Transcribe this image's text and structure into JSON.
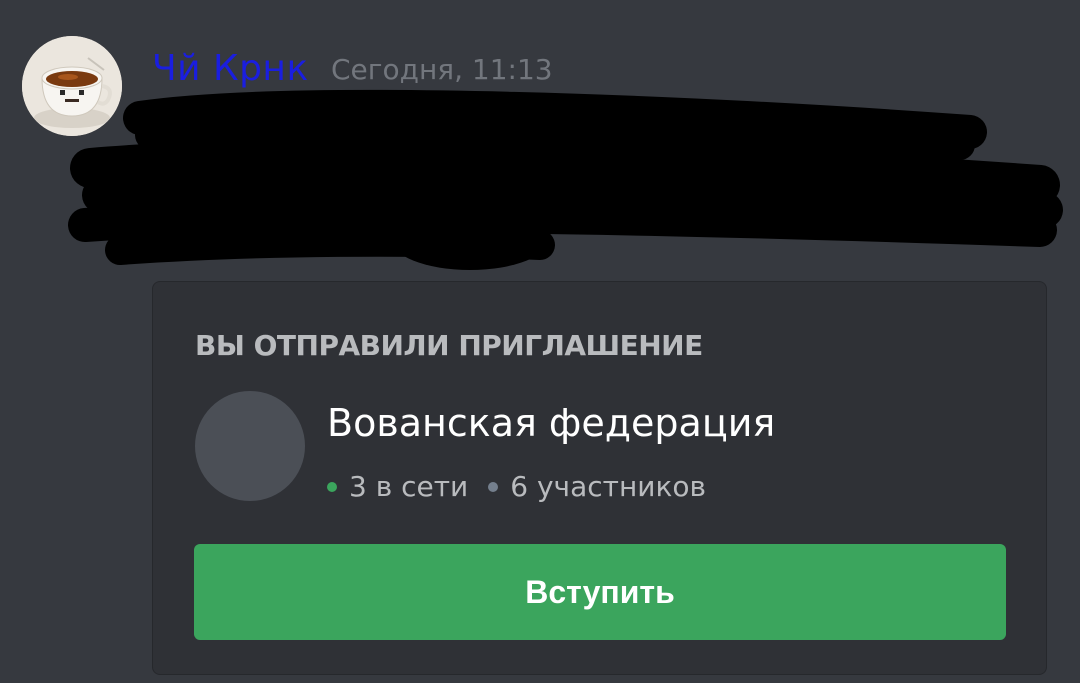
{
  "message": {
    "author": "Чй Крнк",
    "timestamp": "Сегодня, 11:13",
    "author_color": "#1a1ee0",
    "avatar_icon": "teacup-avatar-icon"
  },
  "invite": {
    "heading": "ВЫ ОТПРАВИЛИ ПРИГЛАШЕНИЕ",
    "server_name": "Вованская федерация",
    "online": "3 в сети",
    "members": "6 участников",
    "join_label": "Вступить",
    "colors": {
      "background": "#2f3136",
      "button": "#3ba55d",
      "online_dot": "#3ba55d",
      "members_dot": "#747f8d"
    }
  }
}
